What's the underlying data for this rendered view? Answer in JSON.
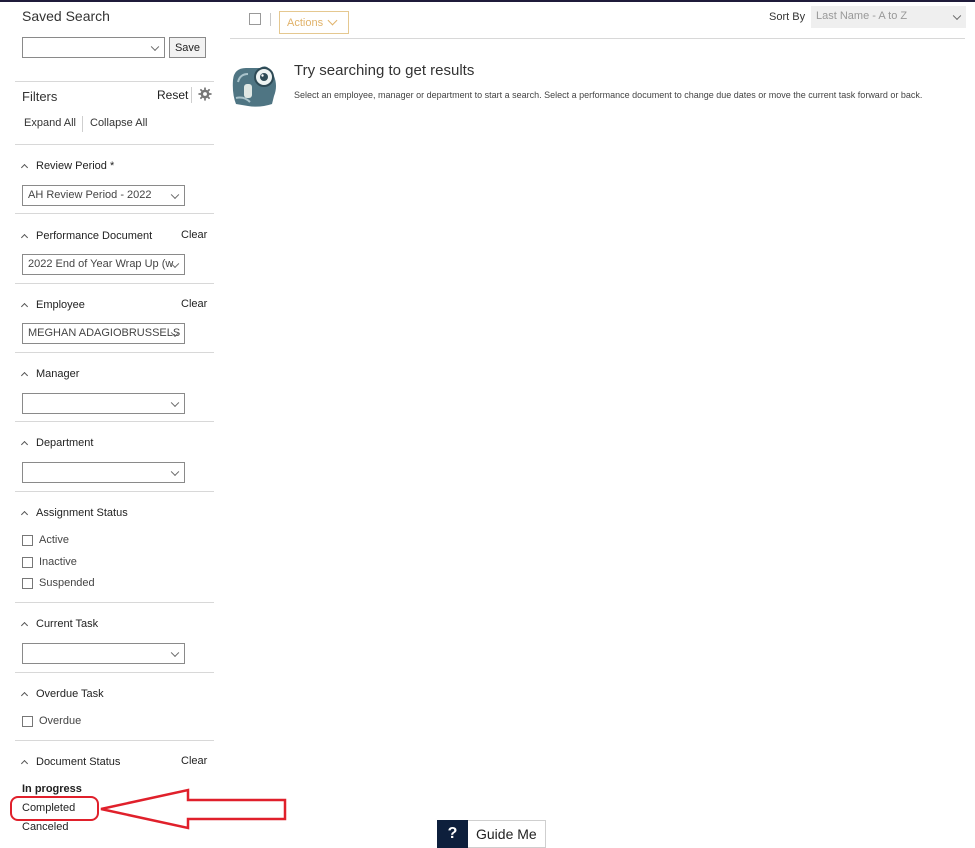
{
  "saved_search": {
    "title": "Saved Search",
    "select_value": "",
    "save_label": "Save"
  },
  "filters": {
    "title": "Filters",
    "reset_label": "Reset",
    "expand_all": "Expand All",
    "collapse_all": "Collapse All"
  },
  "sections": {
    "review_period": {
      "title": "Review Period *",
      "value": "AH Review Period - 2022"
    },
    "performance_document": {
      "title": "Performance Document",
      "clear": "Clear",
      "value": "2022 End of Year Wrap Up (w"
    },
    "employee": {
      "title": "Employee",
      "clear": "Clear",
      "value": "MEGHAN ADAGIOBRUSSELS"
    },
    "manager": {
      "title": "Manager",
      "value": ""
    },
    "department": {
      "title": "Department",
      "value": ""
    },
    "assignment_status": {
      "title": "Assignment Status",
      "options": [
        "Active",
        "Inactive",
        "Suspended"
      ]
    },
    "current_task": {
      "title": "Current Task",
      "value": ""
    },
    "overdue_task": {
      "title": "Overdue Task",
      "options": [
        "Overdue"
      ]
    },
    "document_status": {
      "title": "Document Status",
      "clear": "Clear",
      "options": [
        "In progress",
        "Completed",
        "Canceled"
      ]
    }
  },
  "toolbar": {
    "actions_label": "Actions",
    "sort_by_label": "Sort By",
    "sort_value": "Last Name - A to Z"
  },
  "empty_state": {
    "title": "Try searching to get results",
    "description": "Select an employee, manager or department to start a search. Select a performance document to change due dates or move the current task forward or back."
  },
  "guide": {
    "icon_glyph": "?",
    "label": "Guide Me"
  },
  "colors": {
    "annotation": "#e0202b",
    "guide_dark": "#0d1f3c",
    "actions_accent": "#e0b26a"
  }
}
